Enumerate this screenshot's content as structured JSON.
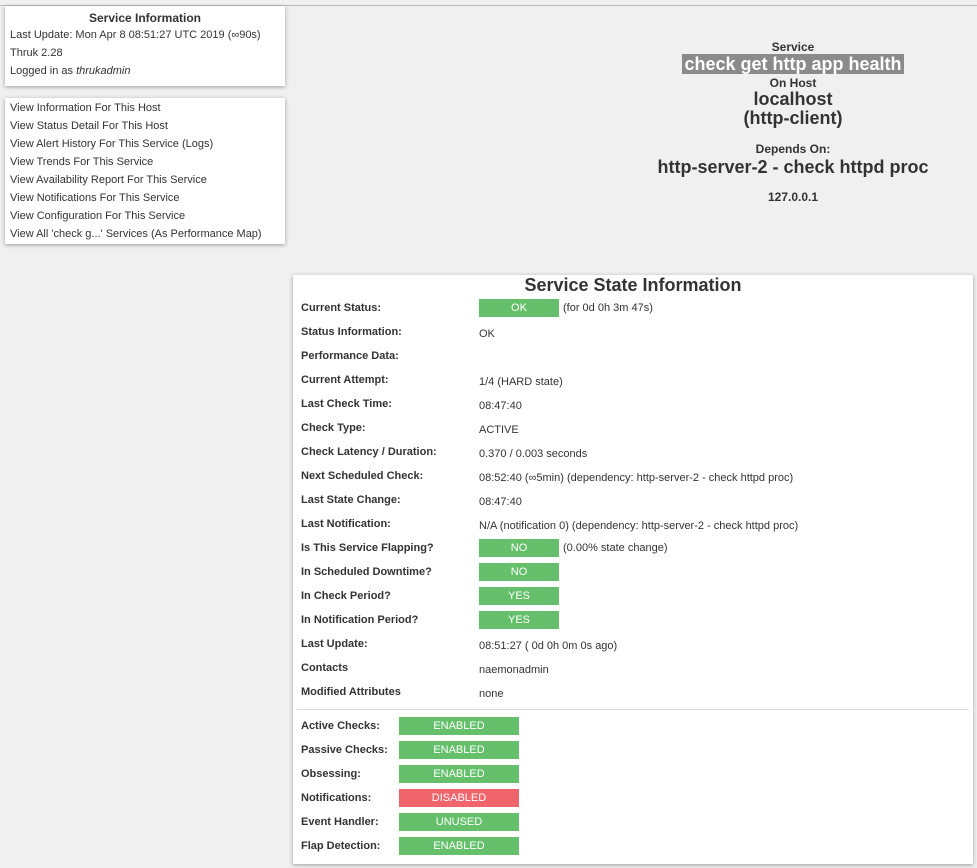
{
  "service_info": {
    "title": "Service Information",
    "last_update": "Last Update: Mon Apr 8 08:51:27 UTC 2019 (∞90s)",
    "version": "Thruk 2.28",
    "logged_in_prefix": "Logged in as ",
    "logged_in_user": "thrukadmin"
  },
  "links": [
    "View Information For This Host",
    "View Status Detail For This Host",
    "View Alert History For This Service (Logs)",
    "View Trends For This Service",
    "View Availability Report For This Service",
    "View Notifications For This Service",
    "View Configuration For This Service",
    "View All 'check g...' Services (As Performance Map)"
  ],
  "header": {
    "service_label": "Service",
    "service_name": "check get http app health",
    "on_host_label": "On Host",
    "host_name": "localhost",
    "host_alias": "(http-client)",
    "depends_label": "Depends On:",
    "depends_name": "http-server-2 - check httpd proc",
    "ip": "127.0.0.1"
  },
  "state": {
    "title": "Service State Information",
    "rows": [
      {
        "label": "Current Status:",
        "badge": "OK",
        "badge_color": "#66c06b",
        "text": "(for 0d 0h 3m 47s)"
      },
      {
        "label": "Status Information:",
        "text": "OK"
      },
      {
        "label": "Performance Data:",
        "text": ""
      },
      {
        "label": "Current Attempt:",
        "text": "1/4  (HARD state)"
      },
      {
        "label": "Last Check Time:",
        "text": "08:47:40"
      },
      {
        "label": "Check Type:",
        "text": "ACTIVE"
      },
      {
        "label": "Check Latency / Duration:",
        "text": "0.370 / 0.003 seconds"
      },
      {
        "label": "Next Scheduled Check:",
        "text": "08:52:40 (∞5min) (dependency: http-server-2 - check httpd proc)"
      },
      {
        "label": "Last State Change:",
        "text": "08:47:40"
      },
      {
        "label": "Last Notification:",
        "text": "N/A (notification 0) (dependency: http-server-2 - check httpd proc)"
      },
      {
        "label": "Is This Service Flapping?",
        "badge": "NO",
        "badge_color": "#66c06b",
        "text": "(0.00% state change)"
      },
      {
        "label": "In Scheduled Downtime?",
        "badge": "NO",
        "badge_color": "#66c06b",
        "text": ""
      },
      {
        "label": "In Check Period?",
        "badge": "YES",
        "badge_color": "#66c06b",
        "text": ""
      },
      {
        "label": "In Notification Period?",
        "badge": "YES",
        "badge_color": "#66c06b",
        "text": ""
      },
      {
        "label": "Last Update:",
        "text": "08:51:27  ( 0d 0h 0m 0s ago)"
      },
      {
        "label": "Contacts",
        "text": "naemonadmin"
      },
      {
        "label": "Modified Attributes",
        "text": "none"
      }
    ],
    "checks": [
      {
        "label": "Active Checks:",
        "badge": "ENABLED",
        "badge_color": "#66c06b"
      },
      {
        "label": "Passive Checks:",
        "badge": "ENABLED",
        "badge_color": "#66c06b"
      },
      {
        "label": "Obsessing:",
        "badge": "ENABLED",
        "badge_color": "#66c06b"
      },
      {
        "label": "Notifications:",
        "badge": "DISABLED",
        "badge_color": "#f0656b"
      },
      {
        "label": "Event Handler:",
        "badge": "UNUSED",
        "badge_color": "#66c06b"
      },
      {
        "label": "Flap Detection:",
        "badge": "ENABLED",
        "badge_color": "#66c06b"
      }
    ]
  }
}
